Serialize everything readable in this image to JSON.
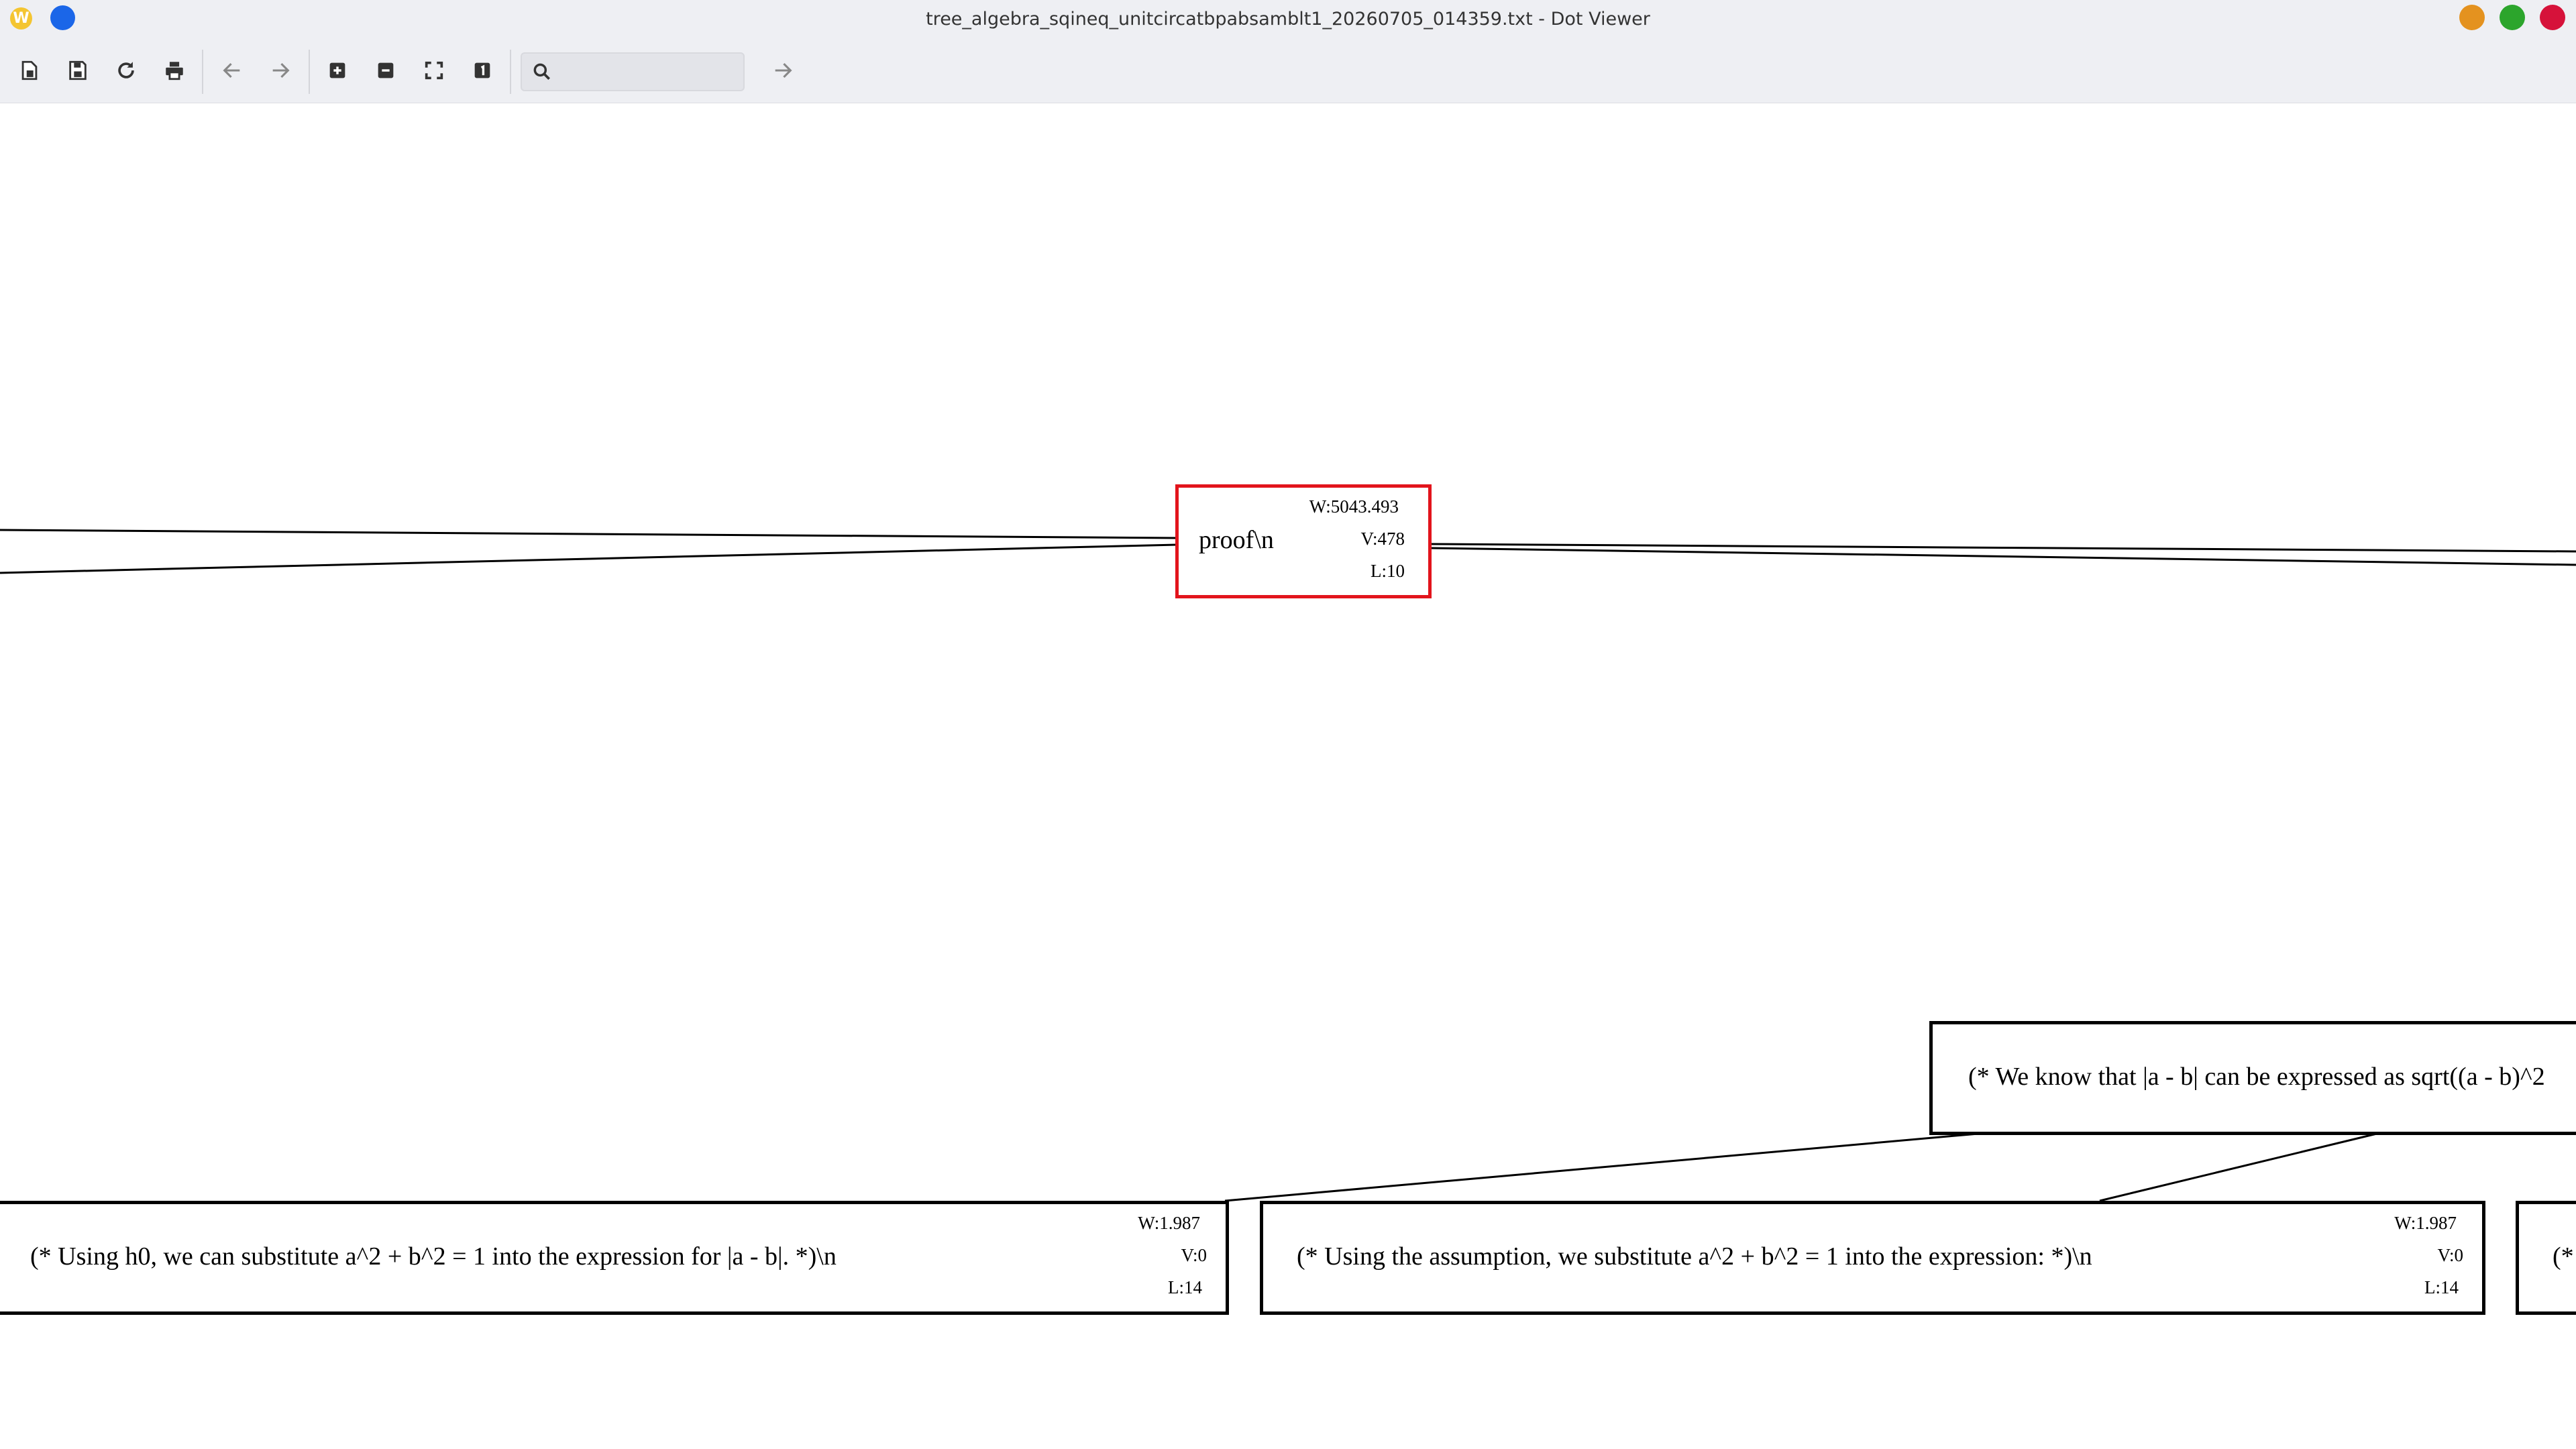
{
  "window": {
    "title": "tree_algebra_sqineq_unitcircatbpabsamblt1_20260705_014359.txt - Dot Viewer",
    "app_icon_letter": "W"
  },
  "toolbar": {
    "search_value": "",
    "buttons": [
      "open-icon",
      "save-icon",
      "reload-icon",
      "print-icon",
      "back-icon",
      "forward-icon",
      "zoom-in-icon",
      "zoom-out-icon",
      "zoom-fit-icon",
      "zoom-100-icon",
      "search-icon",
      "go-icon"
    ]
  },
  "colors": {
    "selected_border": "#e2141c",
    "node_border": "#000000",
    "chrome_bg": "#eeeff3"
  },
  "graph": {
    "root": {
      "label": "proof\\n",
      "w": "W:5043.493",
      "v": "V:478",
      "l": "L:10"
    },
    "mid": {
      "label": "(* We know that |a - b| can be expressed as sqrt((a - b)^2"
    },
    "leaf_left": {
      "label": "(* Using h0, we can substitute a^2 + b^2 = 1 into the expression for |a - b|. *)\\n",
      "w": "W:1.987",
      "v": "V:0",
      "l": "L:14"
    },
    "leaf_right": {
      "label": "(* Using the assumption, we substitute a^2 + b^2 = 1 into the expression: *)\\n",
      "w": "W:1.987",
      "v": "V:0",
      "l": "L:14"
    },
    "leaf_partial": {
      "label": "(*"
    }
  }
}
